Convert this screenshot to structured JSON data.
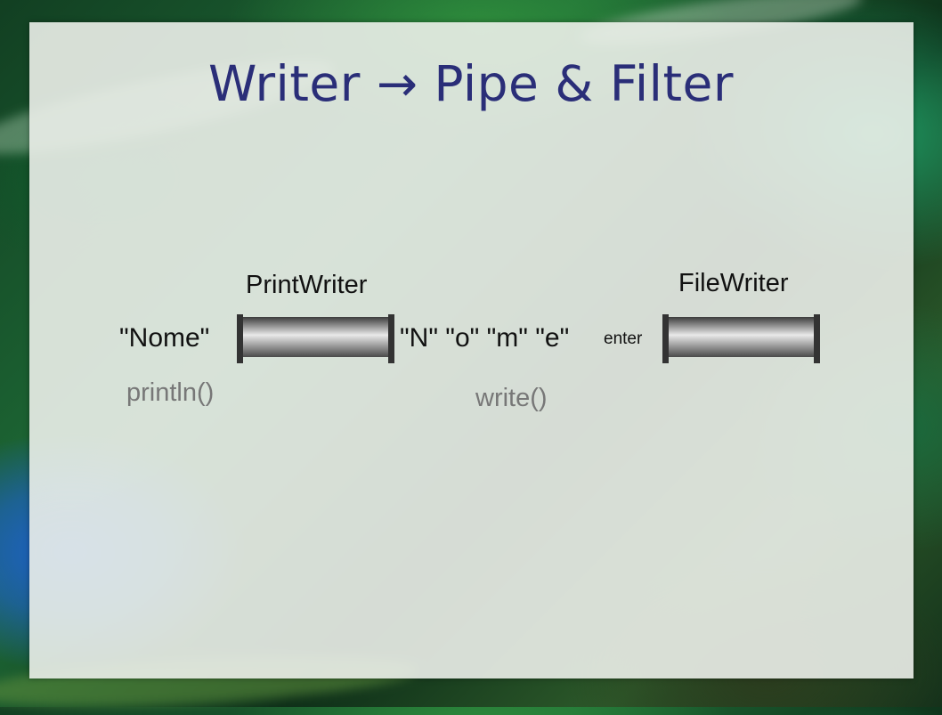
{
  "slide": {
    "title": "Writer → Pipe & Filter"
  },
  "diagram": {
    "input_text": "\"Nome\"",
    "filter_1_label": "PrintWriter",
    "filter_1_method": "println()",
    "chars_text": "\"N\" \"o\" \"m\" \"e\"",
    "enter_text": "enter",
    "filter_2_label": "FileWriter",
    "filter_2_method": "write()"
  },
  "colors": {
    "title": "#2a2e78",
    "pipe_dark": "#3a3a3a",
    "pipe_light": "#e6e6e6"
  }
}
